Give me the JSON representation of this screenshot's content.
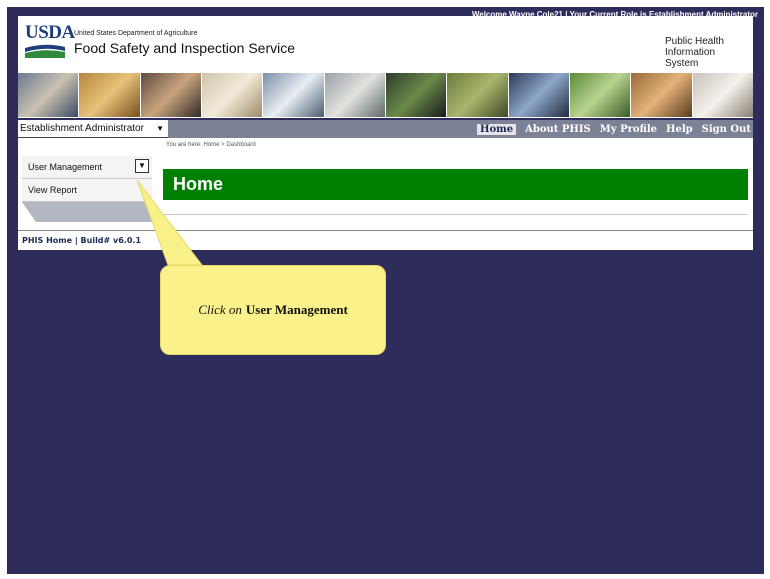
{
  "header": {
    "welcome_text": "Welcome Wayne Cole21  |  Your Current Role is Establishment Administrator",
    "usda_logo_text": "USDA",
    "department": "United States Department of Agriculture",
    "agency": "Food Safety and Inspection Service",
    "system_name_line1": "Public Health",
    "system_name_line2": "Information System"
  },
  "navbar": {
    "role_select_value": "Establishment Administrator",
    "links": [
      "Home",
      "About PHIS",
      "My Profile",
      "Help",
      "Sign Out"
    ]
  },
  "sidebar": {
    "items": [
      {
        "label": "User Management"
      },
      {
        "label": "View Report"
      }
    ]
  },
  "main": {
    "breadcrumb": "You are here: Home > Dashboard",
    "title": "Home"
  },
  "footer": {
    "text": "PHIS Home | Build# v6.0.1"
  },
  "callout": {
    "prefix": "Click on",
    "target": "User Management"
  },
  "colors": {
    "background": "#2e2c5a",
    "title_bar": "#008000",
    "callout": "#fbf18a"
  }
}
